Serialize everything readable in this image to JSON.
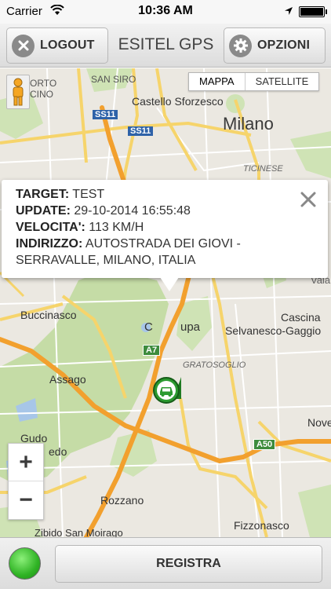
{
  "status_bar": {
    "carrier": "Carrier",
    "time": "10:36 AM"
  },
  "nav": {
    "logout_label": "LOGOUT",
    "title": "ESITEL GPS",
    "options_label": "OPZIONI"
  },
  "map": {
    "type_toggle": {
      "map_label": "MAPPA",
      "satellite_label": "SATELLITE",
      "selected": "MAPPA"
    },
    "place_labels": {
      "porto_1": "ORTO",
      "porto_2": "CINO",
      "san_siro": "SAN SIRO",
      "castello": "Castello Sforzesco",
      "milano": "Milano",
      "ticinese": "TICINESE",
      "ss11_a": "SS11",
      "ss11_b": "SS11",
      "vaia": "Vaia",
      "buccinasco": "Buccinasco",
      "ca_lupa_1": "C",
      "ca_lupa_2": "upa",
      "cascina_1": "Cascina",
      "cascina_2": "Selvanesco-Gaggio",
      "gratosoglio": "GRATOSOGLIO",
      "assago": "Assago",
      "a7": "A7",
      "a50": "A50",
      "nove": "Nove",
      "gudo_1": "Gudo",
      "gudo_2": "edo",
      "rozzano": "Rozzano",
      "fizzonasco": "Fizzonasco",
      "zibido": "Zibido San Moirago"
    },
    "info_window": {
      "target_label": "TARGET:",
      "target_value": "TEST",
      "update_label": "UPDATE:",
      "update_value": "29-10-2014 16:55:48",
      "speed_label": "VELOCITA':",
      "speed_value": "113 KM/H",
      "address_label": "INDIRIZZO:",
      "address_value": "AUTOSTRADA DEI GIOVI -",
      "address_value_2": "SERRAVALLE, MILANO, ITALIA"
    },
    "zoom": {
      "in_label": "+",
      "out_label": "−"
    },
    "icons": {
      "pegman": "pegman-icon",
      "close": "close-icon",
      "marker": "car-marker-icon"
    }
  },
  "bottom": {
    "register_label": "REGISTRA",
    "status_color": "#2fb324"
  }
}
